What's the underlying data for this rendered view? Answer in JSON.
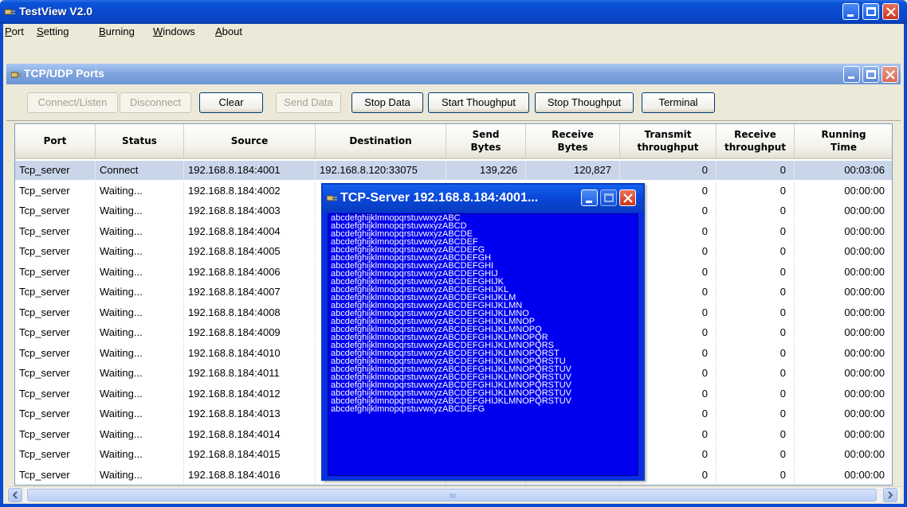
{
  "app": {
    "title": "TestView V2.0"
  },
  "menu": [
    {
      "label": "Port",
      "u": "P"
    },
    {
      "label": "Setting",
      "u": "S"
    },
    {
      "label": "Burning",
      "u": "B"
    },
    {
      "label": "Windows",
      "u": "W"
    },
    {
      "label": "About",
      "u": "A"
    }
  ],
  "child_window": {
    "title": "TCP/UDP Ports"
  },
  "toolbar": {
    "connect": "Connect/Listen",
    "disconnect": "Disconnect",
    "clear": "Clear",
    "send": "Send Data",
    "stop_data": "Stop Data",
    "start_throughput": "Start Thoughput",
    "stop_throughput": "Stop Thoughput",
    "terminal": "Terminal"
  },
  "table": {
    "headers": [
      "Port",
      "Status",
      "Source",
      "Destination",
      "Send\nBytes",
      "Receive\nBytes",
      "Transmit\nthroughput",
      "Receive\nthroughput",
      "Running\nTime"
    ],
    "rows": [
      [
        "Tcp_server",
        "Connect",
        "192.168.8.184:4001",
        "192.168.8.120:33075",
        "139,226",
        "120,827",
        "0",
        "0",
        "00:03:06"
      ],
      [
        "Tcp_server",
        "Waiting...",
        "192.168.8.184:4002",
        "",
        "",
        "",
        "0",
        "0",
        "00:00:00"
      ],
      [
        "Tcp_server",
        "Waiting...",
        "192.168.8.184:4003",
        "",
        "",
        "",
        "0",
        "0",
        "00:00:00"
      ],
      [
        "Tcp_server",
        "Waiting...",
        "192.168.8.184:4004",
        "",
        "",
        "",
        "0",
        "0",
        "00:00:00"
      ],
      [
        "Tcp_server",
        "Waiting...",
        "192.168.8.184:4005",
        "",
        "",
        "",
        "0",
        "0",
        "00:00:00"
      ],
      [
        "Tcp_server",
        "Waiting...",
        "192.168.8.184:4006",
        "",
        "",
        "",
        "0",
        "0",
        "00:00:00"
      ],
      [
        "Tcp_server",
        "Waiting...",
        "192.168.8.184:4007",
        "",
        "",
        "",
        "0",
        "0",
        "00:00:00"
      ],
      [
        "Tcp_server",
        "Waiting...",
        "192.168.8.184:4008",
        "",
        "",
        "",
        "0",
        "0",
        "00:00:00"
      ],
      [
        "Tcp_server",
        "Waiting...",
        "192.168.8.184:4009",
        "",
        "",
        "",
        "0",
        "0",
        "00:00:00"
      ],
      [
        "Tcp_server",
        "Waiting...",
        "192.168.8.184:4010",
        "",
        "",
        "",
        "0",
        "0",
        "00:00:00"
      ],
      [
        "Tcp_server",
        "Waiting...",
        "192.168.8.184:4011",
        "",
        "",
        "",
        "0",
        "0",
        "00:00:00"
      ],
      [
        "Tcp_server",
        "Waiting...",
        "192.168.8.184:4012",
        "",
        "",
        "",
        "0",
        "0",
        "00:00:00"
      ],
      [
        "Tcp_server",
        "Waiting...",
        "192.168.8.184:4013",
        "",
        "",
        "",
        "0",
        "0",
        "00:00:00"
      ],
      [
        "Tcp_server",
        "Waiting...",
        "192.168.8.184:4014",
        "",
        "",
        "",
        "0",
        "0",
        "00:00:00"
      ],
      [
        "Tcp_server",
        "Waiting...",
        "192.168.8.184:4015",
        "",
        "",
        "",
        "0",
        "0",
        "00:00:00"
      ],
      [
        "Tcp_server",
        "Waiting...",
        "192.168.8.184:4016",
        "",
        "",
        "",
        "0",
        "0",
        "00:00:00"
      ]
    ]
  },
  "popup": {
    "title": "TCP-Server 192.168.8.184:4001...",
    "lines": [
      "abcdefghijklmnopqrstuvwxyzABC",
      "abcdefghijklmnopqrstuvwxyzABCD",
      "abcdefghijklmnopqrstuvwxyzABCDE",
      "abcdefghijklmnopqrstuvwxyzABCDEF",
      "abcdefghijklmnopqrstuvwxyzABCDEFG",
      "abcdefghijklmnopqrstuvwxyzABCDEFGH",
      "abcdefghijklmnopqrstuvwxyzABCDEFGHI",
      "abcdefghijklmnopqrstuvwxyzABCDEFGHIJ",
      "abcdefghijklmnopqrstuvwxyzABCDEFGHIJK",
      "abcdefghijklmnopqrstuvwxyzABCDEFGHIJKL",
      "abcdefghijklmnopqrstuvwxyzABCDEFGHIJKLM",
      "abcdefghijklmnopqrstuvwxyzABCDEFGHIJKLMN",
      "abcdefghijklmnopqrstuvwxyzABCDEFGHIJKLMNO",
      "abcdefghijklmnopqrstuvwxyzABCDEFGHIJKLMNOP",
      "abcdefghijklmnopqrstuvwxyzABCDEFGHIJKLMNOPQ",
      "abcdefghijklmnopqrstuvwxyzABCDEFGHIJKLMNOPQR",
      "abcdefghijklmnopqrstuvwxyzABCDEFGHIJKLMNOPQRS",
      "abcdefghijklmnopqrstuvwxyzABCDEFGHIJKLMNOPQRST",
      "abcdefghijklmnopqrstuvwxyzABCDEFGHIJKLMNOPQRSTU",
      "abcdefghijklmnopqrstuvwxyzABCDEFGHIJKLMNOPQRSTUV",
      "abcdefghijklmnopqrstuvwxyzABCDEFGHIJKLMNOPQRSTUV",
      "abcdefghijklmnopqrstuvwxyzABCDEFGHIJKLMNOPQRSTUV",
      "abcdefghijklmnopqrstuvwxyzABCDEFGHIJKLMNOPQRSTUV",
      "abcdefghijklmnopqrstuvwxyzABCDEFGHIJKLMNOPQRSTUV",
      "abcdefghijklmnopqrstuvwxyzABCDEFG"
    ]
  },
  "colors": {
    "title_blue": "#0a4bd0",
    "popup_blue": "#0000ee",
    "selected_row": "#c9d6ea"
  }
}
